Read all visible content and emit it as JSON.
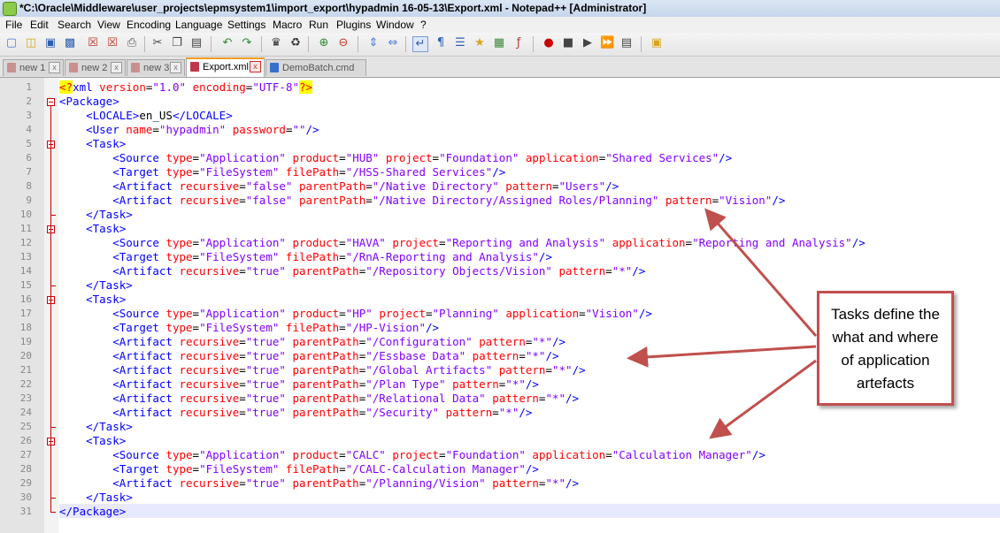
{
  "window": {
    "title": "*C:\\Oracle\\Middleware\\user_projects\\epmsystem1\\import_export\\hypadmin 16-05-13\\Export.xml - Notepad++ [Administrator]"
  },
  "menu": [
    "File",
    "Edit",
    "Search",
    "View",
    "Encoding",
    "Language",
    "Settings",
    "Macro",
    "Run",
    "Plugins",
    "Window",
    "?"
  ],
  "tabs": [
    {
      "label": "new 1",
      "active": false
    },
    {
      "label": "new 2",
      "active": false
    },
    {
      "label": "new 3",
      "active": false
    },
    {
      "label": "Export.xml",
      "active": true
    },
    {
      "label": "DemoBatch.cmd",
      "active": false
    }
  ],
  "editor": {
    "line_numbers": [
      "1",
      "2",
      "3",
      "4",
      "5",
      "6",
      "7",
      "8",
      "9",
      "10",
      "11",
      "12",
      "13",
      "14",
      "15",
      "16",
      "17",
      "18",
      "19",
      "20",
      "21",
      "22",
      "23",
      "24",
      "25",
      "26",
      "27",
      "28",
      "29",
      "30",
      "31"
    ],
    "lines": [
      "<?xml version=\"1.0\" encoding=\"UTF-8\"?>",
      "<Package>",
      "    <LOCALE>en_US</LOCALE>",
      "    <User name=\"hypadmin\" password=\"\"/>",
      "    <Task>",
      "        <Source type=\"Application\" product=\"HUB\" project=\"Foundation\" application=\"Shared Services\"/>",
      "        <Target type=\"FileSystem\" filePath=\"/HSS-Shared Services\"/>",
      "        <Artifact recursive=\"false\" parentPath=\"/Native Directory\" pattern=\"Users\"/>",
      "        <Artifact recursive=\"false\" parentPath=\"/Native Directory/Assigned Roles/Planning\" pattern=\"Vision\"/>",
      "    </Task>",
      "    <Task>",
      "        <Source type=\"Application\" product=\"HAVA\" project=\"Reporting and Analysis\" application=\"Reporting and Analysis\"/>",
      "        <Target type=\"FileSystem\" filePath=\"/RnA-Reporting and Analysis\"/>",
      "        <Artifact recursive=\"true\" parentPath=\"/Repository Objects/Vision\" pattern=\"*\"/>",
      "    </Task>",
      "    <Task>",
      "        <Source type=\"Application\" product=\"HP\" project=\"Planning\" application=\"Vision\"/>",
      "        <Target type=\"FileSystem\" filePath=\"/HP-Vision\"/>",
      "        <Artifact recursive=\"true\" parentPath=\"/Configuration\" pattern=\"*\"/>",
      "        <Artifact recursive=\"true\" parentPath=\"/Essbase Data\" pattern=\"*\"/>",
      "        <Artifact recursive=\"true\" parentPath=\"/Global Artifacts\" pattern=\"*\"/>",
      "        <Artifact recursive=\"true\" parentPath=\"/Plan Type\" pattern=\"*\"/>",
      "        <Artifact recursive=\"true\" parentPath=\"/Relational Data\" pattern=\"*\"/>",
      "        <Artifact recursive=\"true\" parentPath=\"/Security\" pattern=\"*\"/>",
      "    </Task>",
      "    <Task>",
      "        <Source type=\"Application\" product=\"CALC\" project=\"Foundation\" application=\"Calculation Manager\"/>",
      "        <Target type=\"FileSystem\" filePath=\"/CALC-Calculation Manager\"/>",
      "        <Artifact recursive=\"true\" parentPath=\"/Planning/Vision\" pattern=\"*\"/>",
      "    </Task>",
      "</Package>"
    ]
  },
  "callout": {
    "lines": [
      "Tasks define the",
      "what and where",
      "of application",
      "artefacts"
    ],
    "border_color": "#c0504d"
  },
  "icons": [
    "new-file-icon",
    "open-icon",
    "save-icon",
    "save-all-icon",
    "close-icon",
    "close-all-icon",
    "print-icon",
    "cut-icon",
    "copy-icon",
    "paste-icon",
    "undo-icon",
    "redo-icon",
    "find-icon",
    "replace-icon",
    "zoom-in-icon",
    "zoom-out-icon",
    "sync-v-icon",
    "sync-h-icon",
    "wrap-icon",
    "all-chars-icon",
    "indent-guide-icon",
    "udl-icon",
    "doc-map-icon",
    "function-list-icon",
    "record-icon",
    "stop-icon",
    "play-icon",
    "play-multi-icon",
    "save-macro-icon",
    "trim-icon"
  ]
}
